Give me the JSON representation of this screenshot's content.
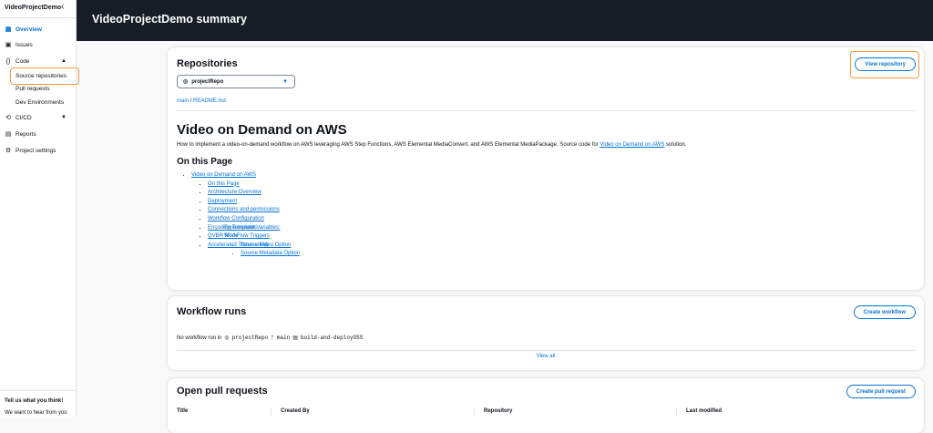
{
  "sidebar": {
    "title": "VideoProjectDemo",
    "items": [
      {
        "label": "Overview",
        "icon": "grid-icon"
      },
      {
        "label": "Issues",
        "icon": "issues-icon"
      },
      {
        "label": "Code",
        "icon": "code-icon"
      },
      {
        "label": "CI/CD",
        "icon": "cicd-icon"
      },
      {
        "label": "Reports",
        "icon": "reports-icon"
      },
      {
        "label": "Project settings",
        "icon": "gear-icon"
      }
    ],
    "code_sub": [
      "Source repositories",
      "Pull requests",
      "Dev Environments"
    ],
    "feedback_title": "Tell us what you think!",
    "feedback_text": "We want to hear from you"
  },
  "header": {
    "title": "VideoProjectDemo summary"
  },
  "repositories": {
    "title": "Repositories",
    "view_button": "View repository",
    "selected_repo": "projectRepo",
    "branch": "main",
    "file": "README.md",
    "readme": {
      "h1": "Video on Demand on AWS",
      "intro": "How to implement a video-on-demand workflow on AWS leveraging AWS Step Functions, AWS Elemental MediaConvert, and AWS Elemental MediaPackage. Source code for ",
      "intro_link": "Video on Demand on AWS",
      "intro_end": " solution.",
      "h2": "On this Page",
      "toc": {
        "top": "Video on Demand on AWS",
        "l2a": [
          "On this Page",
          "Architecture Overview",
          "Deployment",
          "Connections and permissions",
          "Workflow Configuration"
        ],
        "l3": [
          "Environment Variables:",
          "WorkFlow Triggers"
        ],
        "l4": [
          "Source Video Option",
          "Source Metadata Option"
        ],
        "l2b": [
          "Encoding Templates",
          "QVBR Mode",
          "Accelerated Transcoding"
        ]
      }
    }
  },
  "workflows": {
    "title": "Workflow runs",
    "create_button": "Create workflow",
    "empty_prefix": "No workflow run in",
    "repo": "projectRepo",
    "branch": "main",
    "workflow": "build-and-deployOSS",
    "view_all": "View all"
  },
  "pull_requests": {
    "title": "Open pull requests",
    "create_button": "Create pull request",
    "columns": [
      "Title",
      "Created By",
      "Repository",
      "Last modified"
    ]
  }
}
